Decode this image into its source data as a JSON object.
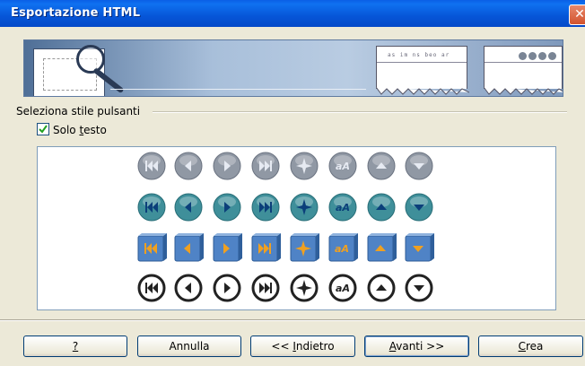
{
  "window": {
    "title": "Esportazione HTML",
    "close_glyph": "✕"
  },
  "banner": {
    "ticket_text": "as im ns beo ar"
  },
  "section": {
    "label": "Seleziona stile pulsanti"
  },
  "checkbox": {
    "label_prefix": "Solo ",
    "label_accel": "t",
    "label_suffix": "esto",
    "checked": true
  },
  "button_styles": {
    "rows": [
      {
        "style": "gray-gradient",
        "color": "#9098a4",
        "selected": false
      },
      {
        "style": "teal-gradient",
        "color": "#3f8f9a",
        "selected": false
      },
      {
        "style": "blue-cube-orange-arrows",
        "color": "#4f83c6",
        "selected": false
      },
      {
        "style": "black-outline",
        "color": "#222222",
        "selected": false
      }
    ],
    "icons": [
      "first-icon",
      "previous-icon",
      "next-icon",
      "last-icon",
      "navigator-icon",
      "text-aA-icon",
      "up-icon",
      "down-icon"
    ]
  },
  "footer": {
    "help": {
      "label": "?",
      "accel": "?"
    },
    "cancel": {
      "label": "Annulla"
    },
    "back": {
      "prefix": "<< ",
      "accel": "I",
      "rest": "ndietro"
    },
    "next": {
      "accel": "A",
      "rest": "vanti >>"
    },
    "create": {
      "accel": "C",
      "rest": "rea"
    }
  }
}
